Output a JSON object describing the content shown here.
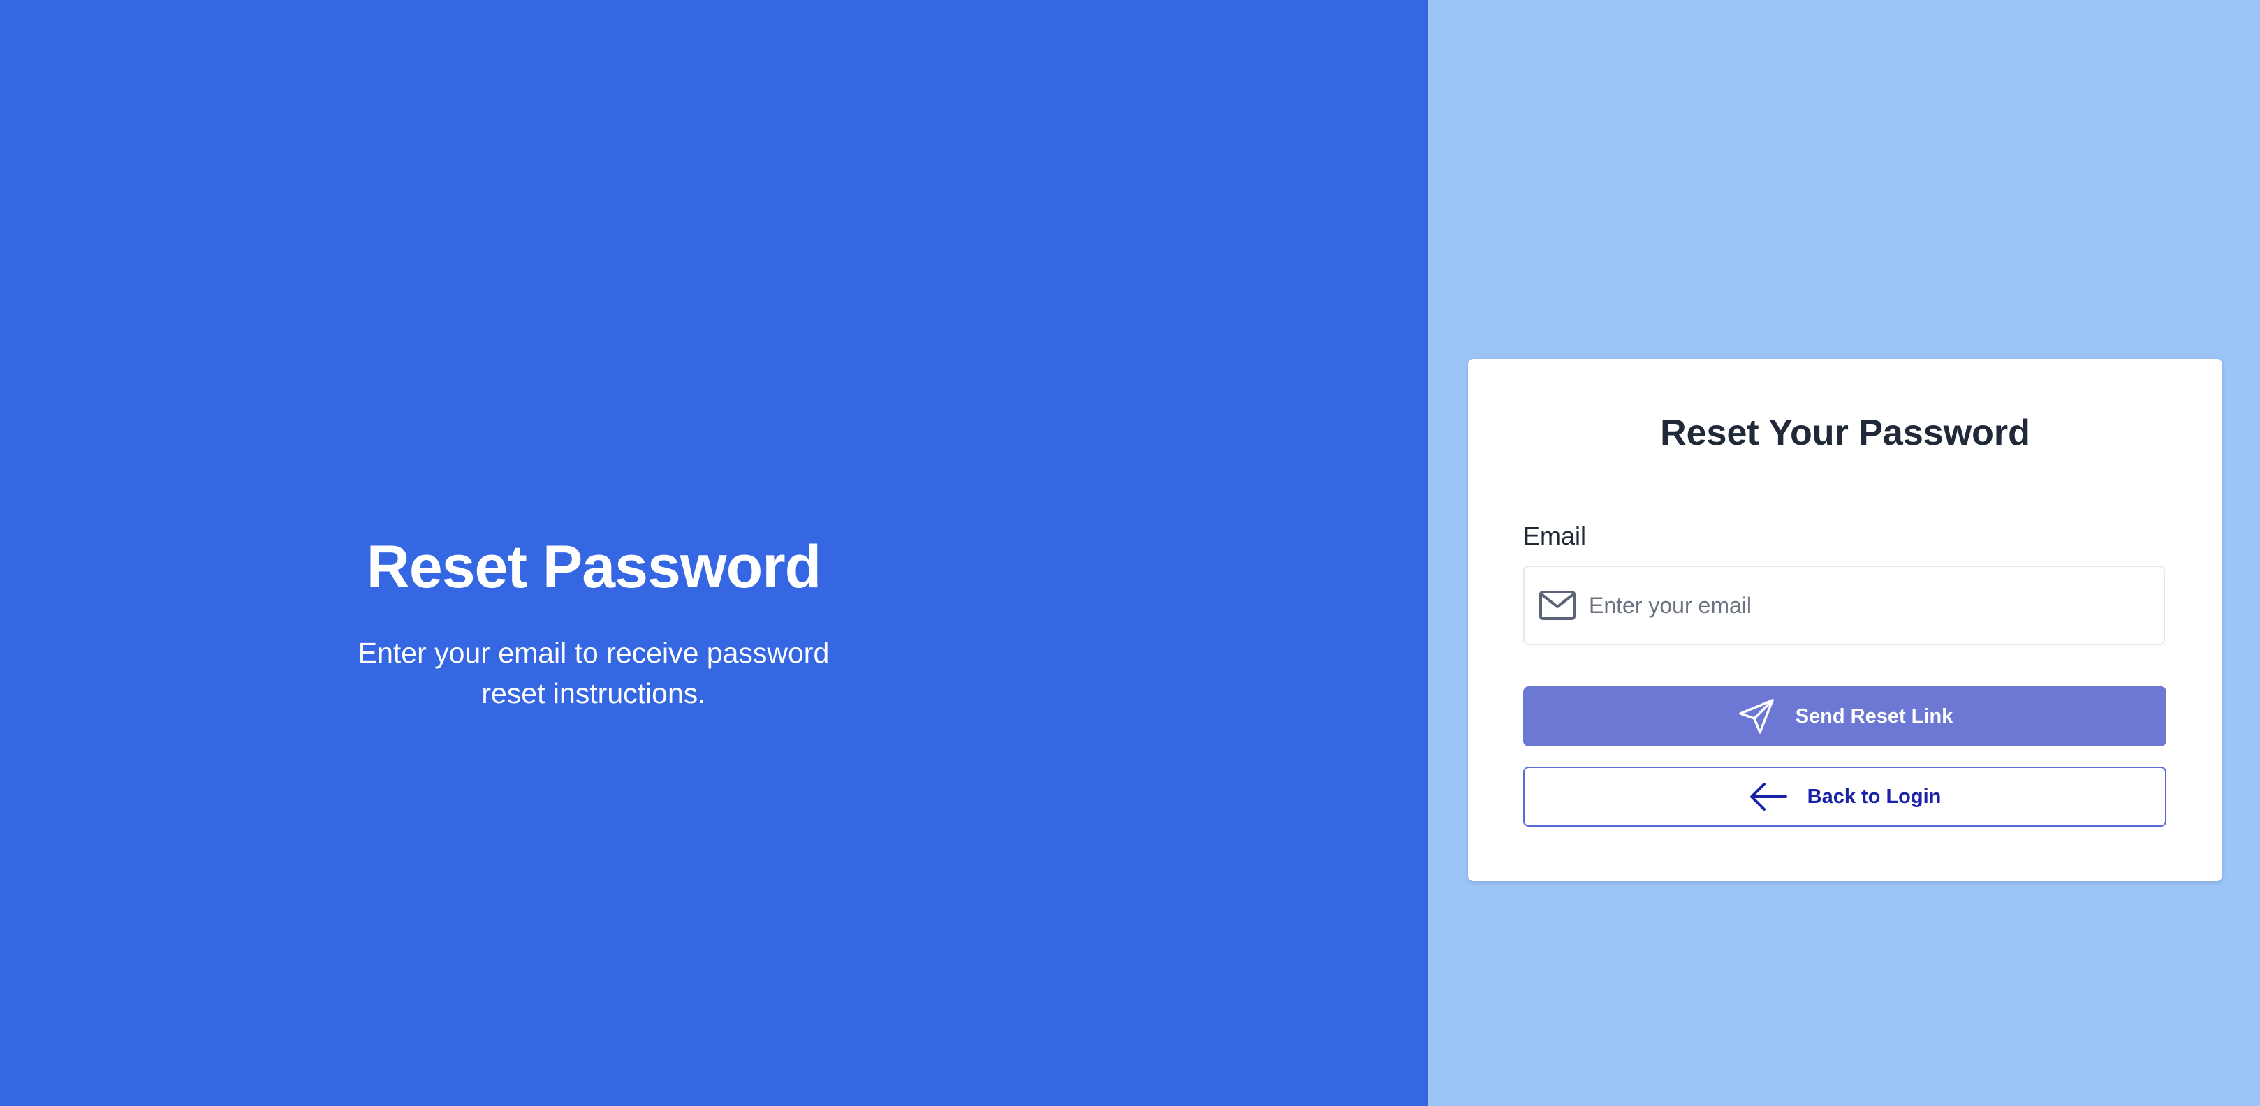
{
  "hero": {
    "title": "Reset Password",
    "subtitle": "Enter your email to receive password reset instructions."
  },
  "card": {
    "title": "Reset Your Password",
    "email_label": "Email",
    "email_placeholder": "Enter your email",
    "email_value": "",
    "send_button_label": "Send Reset Link",
    "back_button_label": "Back to Login"
  },
  "icons": {
    "email": "mail-icon",
    "send": "paper-plane-icon",
    "back": "arrow-left-icon"
  },
  "colors": {
    "left_background": "#3567e2",
    "right_background": "#9dc4f6",
    "card_background": "#ffffff",
    "send_button": "#6c78d3",
    "back_button_text": "#1a22a8",
    "title_text": "#1f2937"
  }
}
